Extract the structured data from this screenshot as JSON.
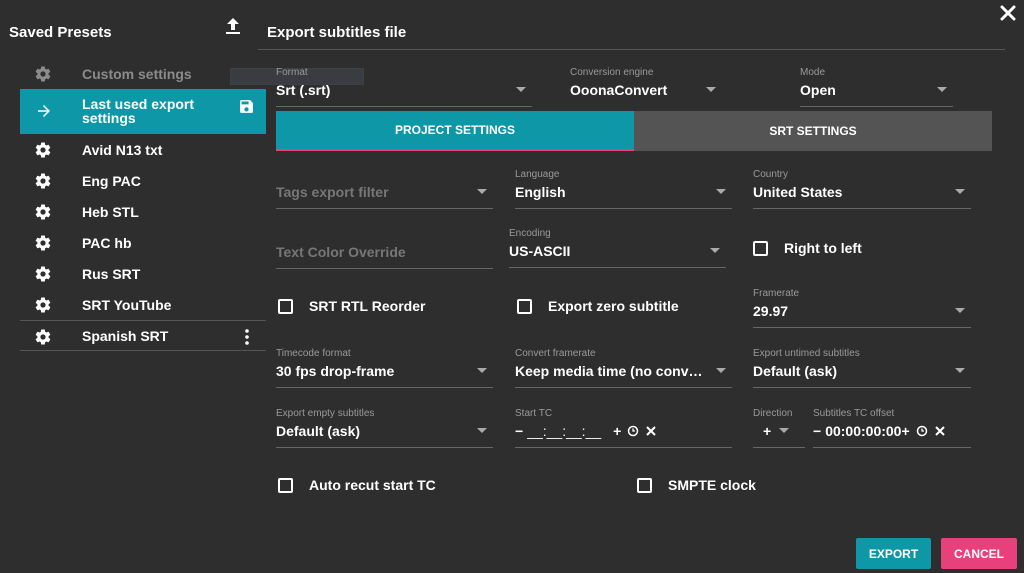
{
  "sidebar": {
    "title": "Saved Presets",
    "items": [
      {
        "label": "Custom settings"
      },
      {
        "label": "Last used export settings"
      },
      {
        "label": "Avid N13 txt"
      },
      {
        "label": "Eng PAC"
      },
      {
        "label": "Heb STL"
      },
      {
        "label": "PAC hb"
      },
      {
        "label": "Rus SRT"
      },
      {
        "label": "SRT YouTube"
      },
      {
        "label": "Spanish SRT"
      }
    ]
  },
  "main": {
    "title": "Export subtitles file",
    "format": {
      "label": "Format",
      "value": "Srt (.srt)"
    },
    "engine": {
      "label": "Conversion engine",
      "value": "OoonaConvert"
    },
    "mode": {
      "label": "Mode",
      "value": "Open"
    },
    "tabs": [
      {
        "label": "PROJECT SETTINGS"
      },
      {
        "label": "SRT SETTINGS"
      }
    ],
    "tags_filter": {
      "placeholder": "Tags export filter"
    },
    "language": {
      "label": "Language",
      "value": "English"
    },
    "country": {
      "label": "Country",
      "value": "United States"
    },
    "text_color": {
      "placeholder": "Text Color Override"
    },
    "encoding": {
      "label": "Encoding",
      "value": "US-ASCII"
    },
    "right_to_left": {
      "label": "Right to left"
    },
    "srt_rtl": {
      "label": "SRT RTL Reorder"
    },
    "export_zero": {
      "label": "Export zero subtitle"
    },
    "framerate": {
      "label": "Framerate",
      "value": "29.97"
    },
    "timecode_format": {
      "label": "Timecode format",
      "value": "30 fps drop-frame"
    },
    "convert_framerate": {
      "label": "Convert framerate",
      "value": "Keep media time (no conv…"
    },
    "export_untimed": {
      "label": "Export untimed subtitles",
      "value": "Default (ask)"
    },
    "export_empty": {
      "label": "Export empty subtitles",
      "value": "Default (ask)"
    },
    "start_tc": {
      "label": "Start TC",
      "value": "__:__:__:__"
    },
    "direction": {
      "label": "Direction",
      "value": "+"
    },
    "tc_offset": {
      "label": "Subtitles TC offset",
      "value": "00:00:00:00"
    },
    "auto_recut": {
      "label": "Auto recut start TC"
    },
    "smpte": {
      "label": "SMPTE clock"
    }
  },
  "buttons": {
    "export": "EXPORT",
    "cancel": "CANCEL"
  },
  "colors": {
    "accent": "#0e98a7",
    "danger": "#e8407a",
    "background": "#2e2e2e"
  }
}
